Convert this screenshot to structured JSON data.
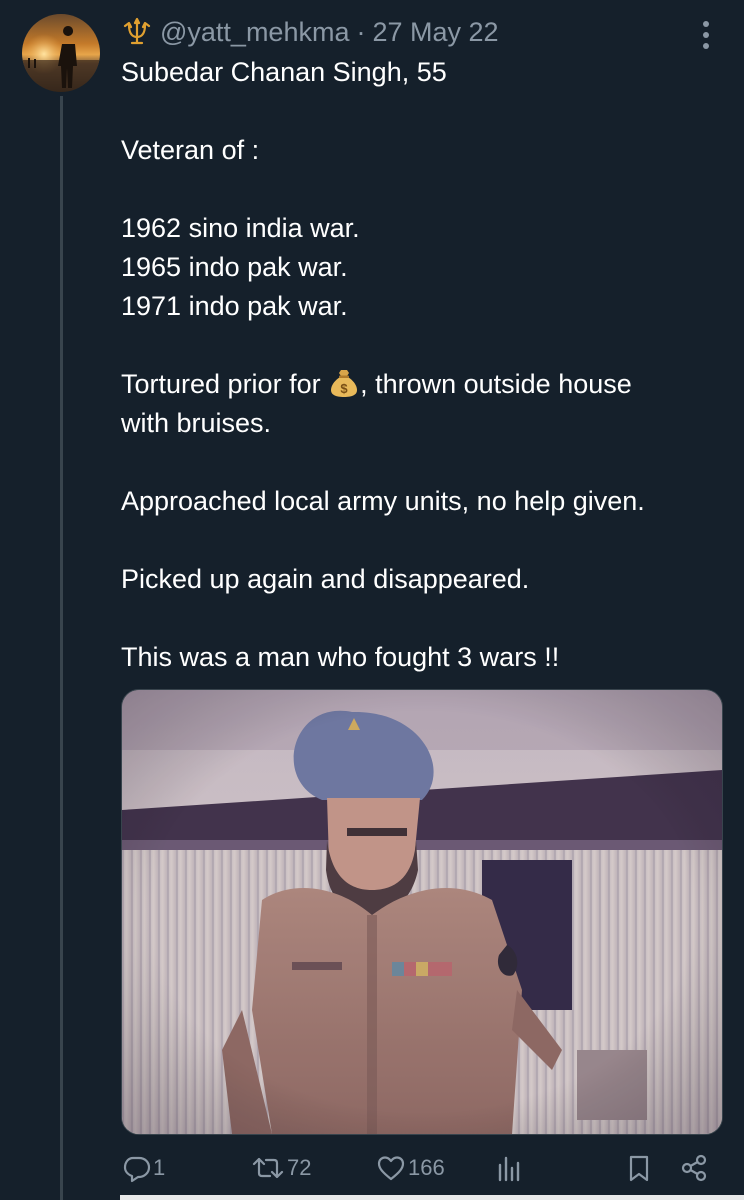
{
  "author": {
    "handle": "@yatt_mehkma",
    "separator": "·",
    "date": "27 May 22",
    "avatar_icon": "avatar-silhouette-sunset",
    "name_icon": "trident-icon"
  },
  "tweet": {
    "lines": {
      "l1": "Subedar Chanan Singh, 55",
      "l2": "Veteran of :",
      "l3": "1962 sino india war.",
      "l4": "1965 indo pak war.",
      "l5": "1971 indo pak war.",
      "l6a": "Tortured prior for ",
      "l6b": ", thrown outside house",
      "l7": "with bruises.",
      "l8": "Approached local army units, no help given.",
      "l9": "Picked up again and disappeared.",
      "l10": "This was a man who fought 3 wars !!"
    },
    "emoji_icon": "money-bag-icon"
  },
  "media": {
    "type": "photo",
    "subject_icon": "photo-soldier-in-turban"
  },
  "actions": {
    "reply_count": "1",
    "retweet_count": "72",
    "like_count": "166",
    "views_icon": "views-icon",
    "bookmark_icon": "bookmark-icon",
    "share_icon": "share-icon"
  },
  "colors": {
    "background": "#15202b",
    "secondary_text": "#8b98a5",
    "thread_line": "#38444d"
  }
}
